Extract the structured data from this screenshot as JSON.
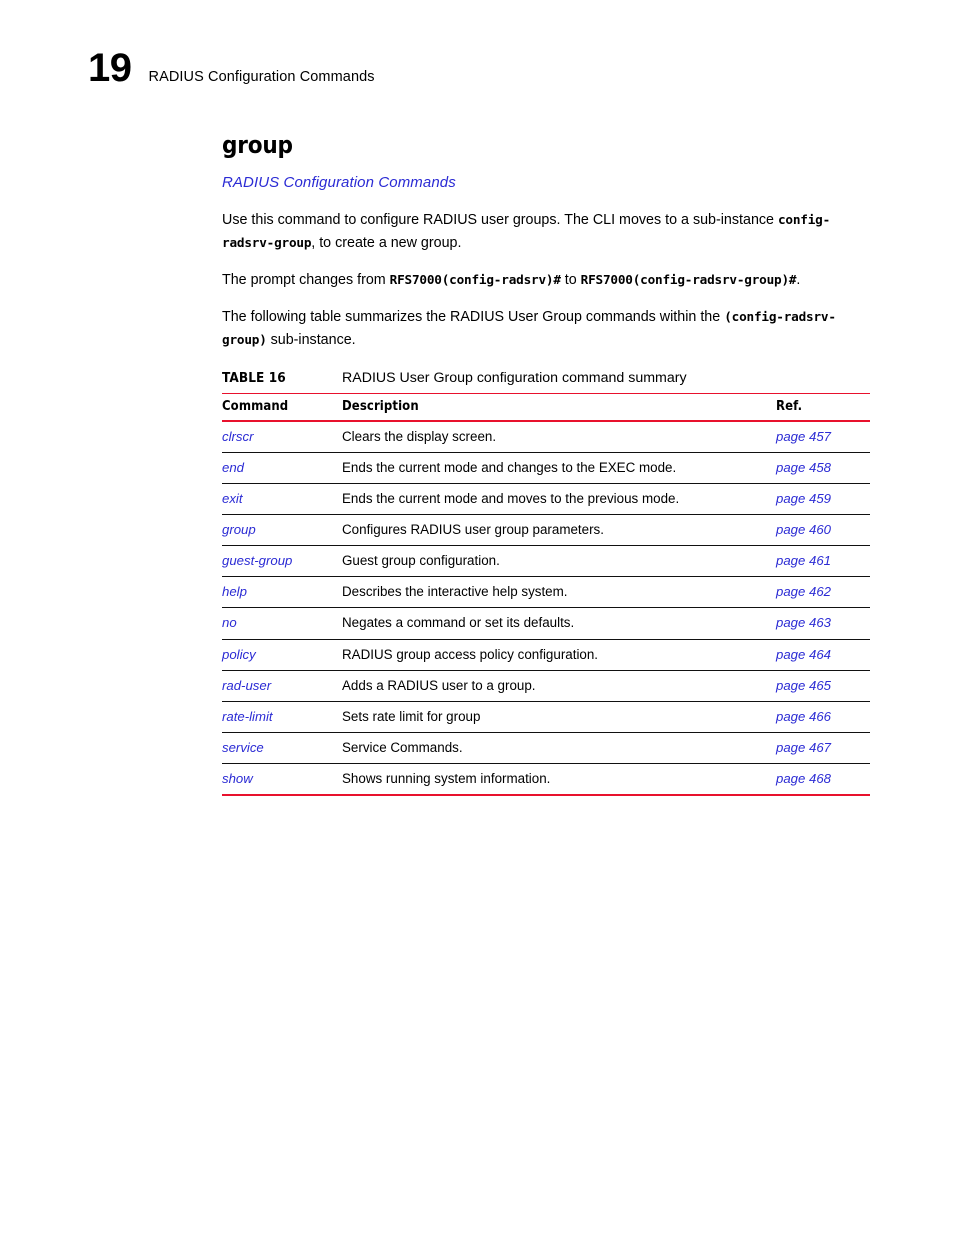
{
  "header": {
    "chapter_number": "19",
    "chapter_title": "RADIUS Configuration Commands"
  },
  "section": {
    "title": "group",
    "breadcrumb_link": "RADIUS Configuration Commands",
    "paragraphs": {
      "p1_a": "Use this command to configure RADIUS user groups. The CLI moves to a sub-instance ",
      "p1_code": "config-radsrv-group",
      "p1_b": ", to create a new group.",
      "p2_a": "The prompt changes from ",
      "p2_code1": "RFS7000(config-radsrv)#",
      "p2_b": " to ",
      "p2_code2": "RFS7000(config-radsrv-group)#",
      "p2_c": ".",
      "p3_a": "The following table summarizes the RADIUS User Group commands within the ",
      "p3_code": "(config-radsrv-group)",
      "p3_b": " sub-instance."
    }
  },
  "table": {
    "label": "TABLE 16",
    "caption": "RADIUS User Group configuration command summary",
    "columns": [
      "Command",
      "Description",
      "Ref."
    ],
    "rows": [
      {
        "command": "clrscr",
        "description": "Clears the display screen.",
        "ref": "page 457"
      },
      {
        "command": "end",
        "description": "Ends the current mode and changes to the EXEC mode.",
        "ref": "page 458"
      },
      {
        "command": "exit",
        "description": "Ends the current mode and moves to the previous mode.",
        "ref": "page 459"
      },
      {
        "command": "group",
        "description": "Configures RADIUS user group parameters.",
        "ref": "page 460"
      },
      {
        "command": "guest-group",
        "description": "Guest group configuration.",
        "ref": "page 461"
      },
      {
        "command": "help",
        "description": "Describes the interactive help system.",
        "ref": "page 462"
      },
      {
        "command": "no",
        "description": "Negates a command or set its defaults.",
        "ref": "page 463"
      },
      {
        "command": "policy",
        "description": "RADIUS group access policy configuration.",
        "ref": "page 464"
      },
      {
        "command": "rad-user",
        "description": "Adds a RADIUS user to a group.",
        "ref": "page 465"
      },
      {
        "command": "rate-limit",
        "description": "Sets rate limit for group",
        "ref": "page 466"
      },
      {
        "command": "service",
        "description": "Service Commands.",
        "ref": "page 467"
      },
      {
        "command": "show",
        "description": "Shows running system information.",
        "ref": "page 468"
      }
    ]
  },
  "colors": {
    "link": "#2b2bd4",
    "rule_accent": "#e8112d",
    "rule_row": "#111111"
  }
}
